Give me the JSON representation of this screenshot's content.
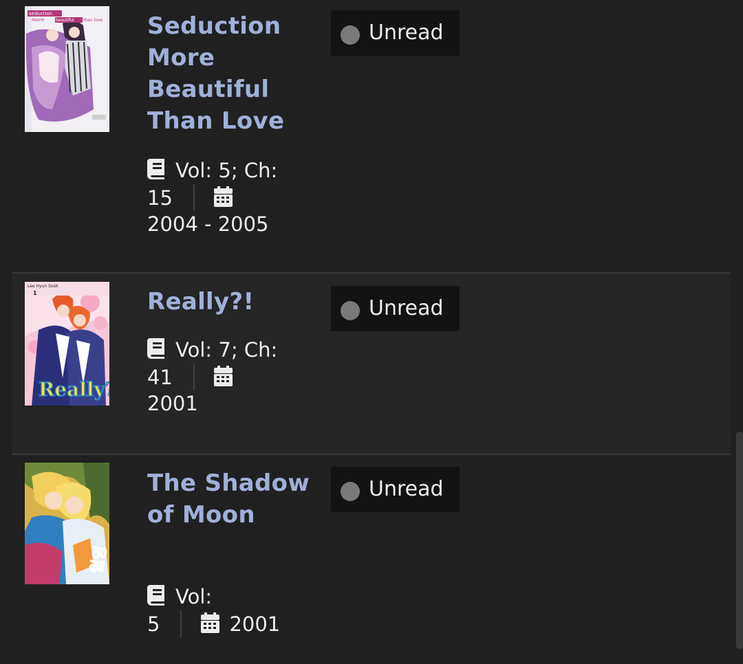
{
  "entries": [
    {
      "title": "Seduction More Beautiful Than Love",
      "volumes_chapters": "Vol: 5; Ch:",
      "volumes_chapters_cont": "15",
      "years": "2004 - 2005",
      "status": "Unread",
      "cover_text": {
        "l1": "seduction",
        "l2": "more",
        "l3": "beautiful",
        "l4": "than love"
      }
    },
    {
      "title": "Really?!",
      "volumes_chapters": "Vol: 7; Ch:",
      "volumes_chapters_cont": "41",
      "years": "2001",
      "status": "Unread",
      "cover_text": {
        "author": "Lee Hyun Sook",
        "vol": "1",
        "logo": "Really?!"
      }
    },
    {
      "title": "The Shadow of Moon",
      "volumes_chapters": "Vol:",
      "volumes_chapters_cont": "5",
      "years": "2001",
      "status": "Unread",
      "cover_text": {
        "logo": "월영"
      }
    }
  ],
  "icons": {
    "book": "book-icon",
    "calendar": "calendar-icon",
    "status": "status-dot-icon"
  },
  "colors": {
    "background": "#202020",
    "title": "#9fb0d8",
    "status_bg": "#131313",
    "status_dot": "#7a7a7a"
  }
}
